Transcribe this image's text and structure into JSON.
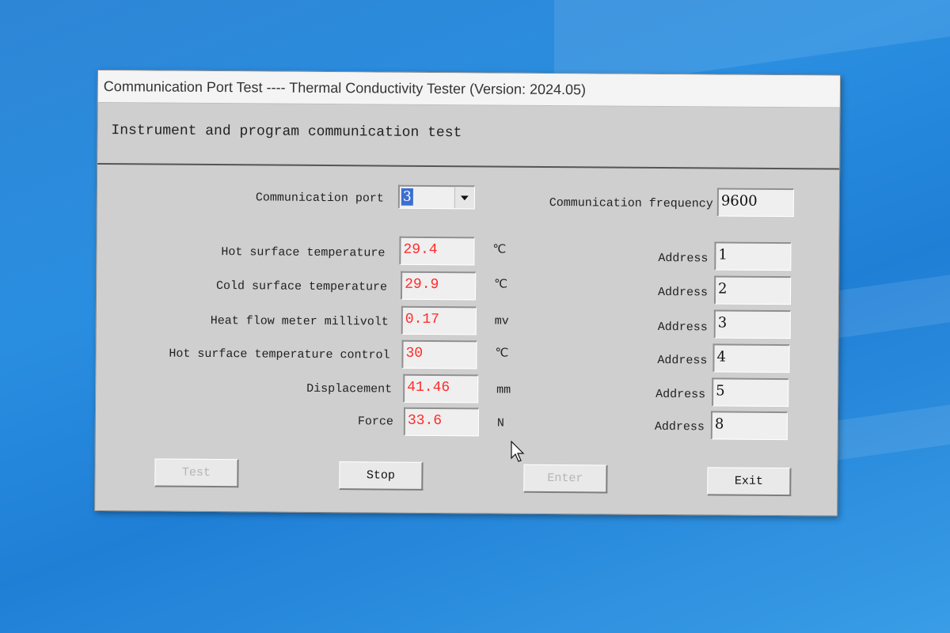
{
  "window": {
    "title": "Communication Port Test ---- Thermal Conductivity Tester (Version: 2024.05)",
    "header": "Instrument and program communication test"
  },
  "settings": {
    "port_label": "Communication port",
    "port_value": "3",
    "frequency_label": "Communication frequency",
    "frequency_value": "9600"
  },
  "readings": [
    {
      "label": "Hot surface temperature",
      "value": "29.4",
      "unit": "℃",
      "address_label": "Address",
      "address": "1"
    },
    {
      "label": "Cold surface temperature",
      "value": "29.9",
      "unit": "℃",
      "address_label": "Address",
      "address": "2"
    },
    {
      "label": "Heat flow meter millivolt",
      "value": "0.17",
      "unit": "mv",
      "address_label": "Address",
      "address": "3"
    },
    {
      "label": "Hot surface temperature control",
      "value": "30",
      "unit": "℃",
      "address_label": "Address",
      "address": "4"
    },
    {
      "label": "Displacement",
      "value": "41.46",
      "unit": "mm",
      "address_label": "Address",
      "address": "5"
    },
    {
      "label": "Force",
      "value": "33.6",
      "unit": "N",
      "address_label": "Address",
      "address": "8"
    }
  ],
  "buttons": {
    "test": "Test",
    "stop": "Stop",
    "enter": "Enter",
    "exit": "Exit"
  },
  "colors": {
    "reading_value": "#ff2a2a",
    "window_bg": "#cfcfcf",
    "desktop": "#2a8ee0"
  }
}
